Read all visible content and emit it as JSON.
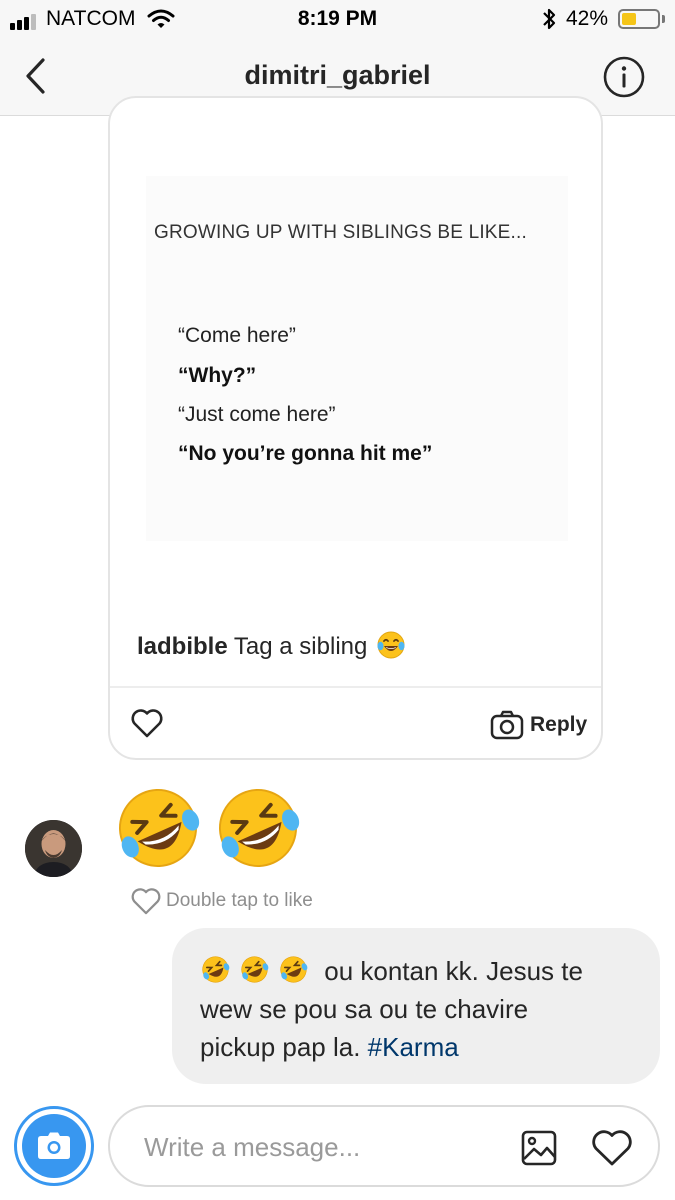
{
  "status_bar": {
    "carrier": "NATCOM",
    "time": "8:19 PM",
    "battery_percent": "42%",
    "battery_level": 0.42,
    "battery_color": "#f5c518",
    "icons": [
      "signal-icon",
      "wifi-icon",
      "bluetooth-icon",
      "battery-icon"
    ]
  },
  "header": {
    "title": "dimitri_gabriel",
    "back_icon": "chevron-left-icon",
    "info_icon": "info-icon"
  },
  "shared_post": {
    "image": {
      "headline": "GROWING UP WITH SIBLINGS BE LIKE...",
      "lines": [
        {
          "text": "“Come here”",
          "bold": false
        },
        {
          "text": "“Why?”",
          "bold": true
        },
        {
          "text": "“Just come here”",
          "bold": false
        },
        {
          "text": "“No you’re gonna hit me”",
          "bold": true
        }
      ]
    },
    "caption_user": "ladbible",
    "caption_text": "Tag a sibling",
    "caption_emoji": "face-with-tears-of-joy",
    "like_icon": "heart-outline-icon",
    "reply_label": "Reply",
    "reply_icon": "camera-outline-icon"
  },
  "received_message": {
    "emojis": [
      "rolling-on-the-floor-laughing",
      "rolling-on-the-floor-laughing"
    ],
    "double_tap_label": "Double tap to like"
  },
  "sent_message": {
    "emojis": [
      "rolling-on-the-floor-laughing",
      "rolling-on-the-floor-laughing",
      "rolling-on-the-floor-laughing"
    ],
    "text_line1": "ou kontan kk. Jesus te",
    "text_line2": "wew se pou sa ou te chavire",
    "text_line3_prefix": "pickup pap la. ",
    "hashtag": "#Karma",
    "hashtag_color": "#00376b"
  },
  "composer": {
    "placeholder": "Write a message...",
    "camera_icon": "camera-icon",
    "gallery_icon": "gallery-icon",
    "heart_icon": "heart-outline-icon",
    "accent_color": "#3897f0"
  }
}
